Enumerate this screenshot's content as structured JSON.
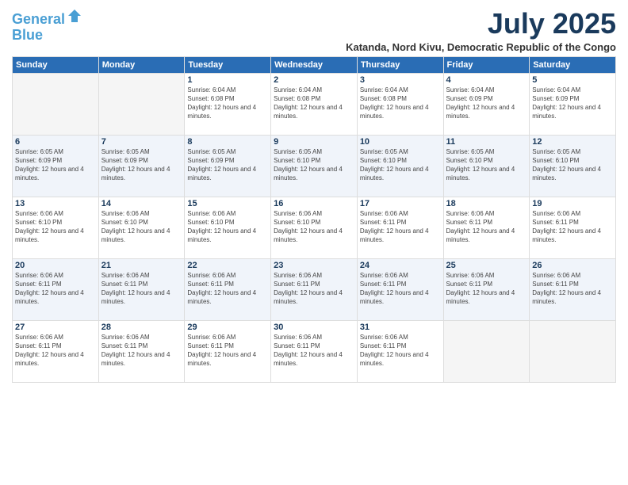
{
  "header": {
    "logo_line1": "General",
    "logo_line2": "Blue",
    "month_year": "July 2025",
    "location": "Katanda, Nord Kivu, Democratic Republic of the Congo"
  },
  "days_of_week": [
    "Sunday",
    "Monday",
    "Tuesday",
    "Wednesday",
    "Thursday",
    "Friday",
    "Saturday"
  ],
  "weeks": [
    [
      {
        "day": "",
        "info": ""
      },
      {
        "day": "",
        "info": ""
      },
      {
        "day": "1",
        "info": "Sunrise: 6:04 AM\nSunset: 6:08 PM\nDaylight: 12 hours and 4 minutes."
      },
      {
        "day": "2",
        "info": "Sunrise: 6:04 AM\nSunset: 6:08 PM\nDaylight: 12 hours and 4 minutes."
      },
      {
        "day": "3",
        "info": "Sunrise: 6:04 AM\nSunset: 6:08 PM\nDaylight: 12 hours and 4 minutes."
      },
      {
        "day": "4",
        "info": "Sunrise: 6:04 AM\nSunset: 6:09 PM\nDaylight: 12 hours and 4 minutes."
      },
      {
        "day": "5",
        "info": "Sunrise: 6:04 AM\nSunset: 6:09 PM\nDaylight: 12 hours and 4 minutes."
      }
    ],
    [
      {
        "day": "6",
        "info": "Sunrise: 6:05 AM\nSunset: 6:09 PM\nDaylight: 12 hours and 4 minutes."
      },
      {
        "day": "7",
        "info": "Sunrise: 6:05 AM\nSunset: 6:09 PM\nDaylight: 12 hours and 4 minutes."
      },
      {
        "day": "8",
        "info": "Sunrise: 6:05 AM\nSunset: 6:09 PM\nDaylight: 12 hours and 4 minutes."
      },
      {
        "day": "9",
        "info": "Sunrise: 6:05 AM\nSunset: 6:10 PM\nDaylight: 12 hours and 4 minutes."
      },
      {
        "day": "10",
        "info": "Sunrise: 6:05 AM\nSunset: 6:10 PM\nDaylight: 12 hours and 4 minutes."
      },
      {
        "day": "11",
        "info": "Sunrise: 6:05 AM\nSunset: 6:10 PM\nDaylight: 12 hours and 4 minutes."
      },
      {
        "day": "12",
        "info": "Sunrise: 6:05 AM\nSunset: 6:10 PM\nDaylight: 12 hours and 4 minutes."
      }
    ],
    [
      {
        "day": "13",
        "info": "Sunrise: 6:06 AM\nSunset: 6:10 PM\nDaylight: 12 hours and 4 minutes."
      },
      {
        "day": "14",
        "info": "Sunrise: 6:06 AM\nSunset: 6:10 PM\nDaylight: 12 hours and 4 minutes."
      },
      {
        "day": "15",
        "info": "Sunrise: 6:06 AM\nSunset: 6:10 PM\nDaylight: 12 hours and 4 minutes."
      },
      {
        "day": "16",
        "info": "Sunrise: 6:06 AM\nSunset: 6:10 PM\nDaylight: 12 hours and 4 minutes."
      },
      {
        "day": "17",
        "info": "Sunrise: 6:06 AM\nSunset: 6:11 PM\nDaylight: 12 hours and 4 minutes."
      },
      {
        "day": "18",
        "info": "Sunrise: 6:06 AM\nSunset: 6:11 PM\nDaylight: 12 hours and 4 minutes."
      },
      {
        "day": "19",
        "info": "Sunrise: 6:06 AM\nSunset: 6:11 PM\nDaylight: 12 hours and 4 minutes."
      }
    ],
    [
      {
        "day": "20",
        "info": "Sunrise: 6:06 AM\nSunset: 6:11 PM\nDaylight: 12 hours and 4 minutes."
      },
      {
        "day": "21",
        "info": "Sunrise: 6:06 AM\nSunset: 6:11 PM\nDaylight: 12 hours and 4 minutes."
      },
      {
        "day": "22",
        "info": "Sunrise: 6:06 AM\nSunset: 6:11 PM\nDaylight: 12 hours and 4 minutes."
      },
      {
        "day": "23",
        "info": "Sunrise: 6:06 AM\nSunset: 6:11 PM\nDaylight: 12 hours and 4 minutes."
      },
      {
        "day": "24",
        "info": "Sunrise: 6:06 AM\nSunset: 6:11 PM\nDaylight: 12 hours and 4 minutes."
      },
      {
        "day": "25",
        "info": "Sunrise: 6:06 AM\nSunset: 6:11 PM\nDaylight: 12 hours and 4 minutes."
      },
      {
        "day": "26",
        "info": "Sunrise: 6:06 AM\nSunset: 6:11 PM\nDaylight: 12 hours and 4 minutes."
      }
    ],
    [
      {
        "day": "27",
        "info": "Sunrise: 6:06 AM\nSunset: 6:11 PM\nDaylight: 12 hours and 4 minutes."
      },
      {
        "day": "28",
        "info": "Sunrise: 6:06 AM\nSunset: 6:11 PM\nDaylight: 12 hours and 4 minutes."
      },
      {
        "day": "29",
        "info": "Sunrise: 6:06 AM\nSunset: 6:11 PM\nDaylight: 12 hours and 4 minutes."
      },
      {
        "day": "30",
        "info": "Sunrise: 6:06 AM\nSunset: 6:11 PM\nDaylight: 12 hours and 4 minutes."
      },
      {
        "day": "31",
        "info": "Sunrise: 6:06 AM\nSunset: 6:11 PM\nDaylight: 12 hours and 4 minutes."
      },
      {
        "day": "",
        "info": ""
      },
      {
        "day": "",
        "info": ""
      }
    ]
  ]
}
